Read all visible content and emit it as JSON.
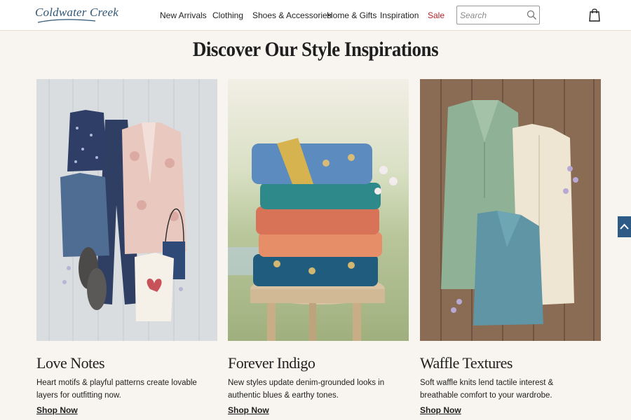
{
  "header": {
    "logo_text": "Coldwater Creek",
    "nav": [
      {
        "label": "New Arrivals"
      },
      {
        "label": "Clothing"
      },
      {
        "label": "Shoes & Accessories"
      },
      {
        "label": "Home & Gifts"
      },
      {
        "label": "Inspiration"
      },
      {
        "label": "Sale"
      }
    ],
    "search": {
      "placeholder": "Search",
      "value": ""
    },
    "icons": {
      "search": "search-icon",
      "bag": "shopping-bag-icon"
    }
  },
  "page": {
    "title": "Discover Our Style Inspirations"
  },
  "cards": [
    {
      "title": "Love Notes",
      "description": "Heart motifs & playful patterns create lovable layers for outfitting now.",
      "link": "Shop Now"
    },
    {
      "title": "Forever Indigo",
      "description": "New styles update denim-grounded looks in authentic blues & earthy tones.",
      "link": "Shop Now"
    },
    {
      "title": "Waffle Textures",
      "description": "Soft waffle knits lend tactile interest & breathable comfort to your wardrobe.",
      "link": "Shop Now"
    }
  ],
  "colors": {
    "background": "#f8f5f0",
    "brand_blue": "#2d5677",
    "sale_red": "#b0242b",
    "back_to_top": "#2e5b85"
  },
  "back_to_top_icon": "chevron-up-icon"
}
